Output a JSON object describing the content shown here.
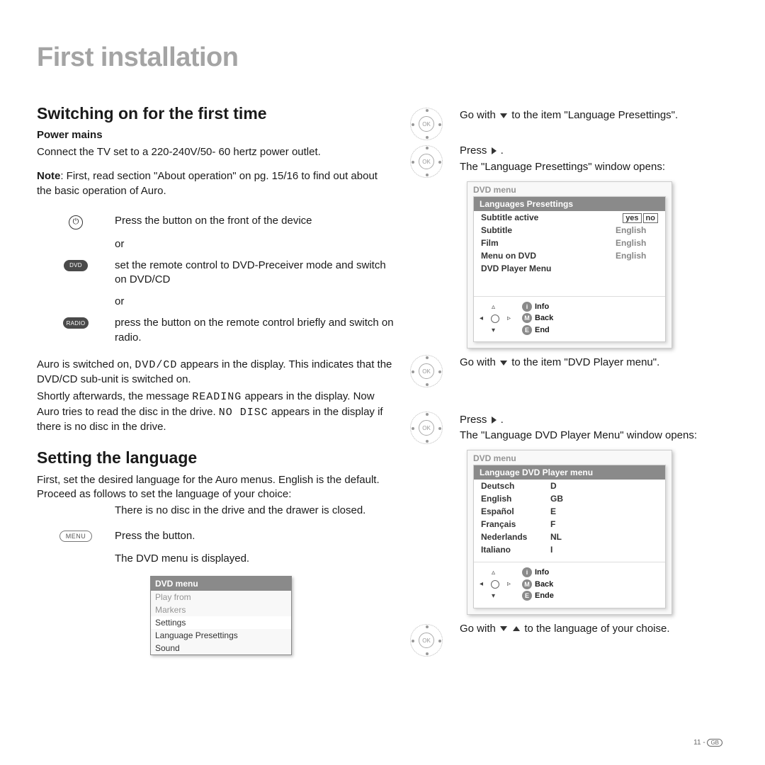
{
  "title": "First installation",
  "left": {
    "h2a": "Switching on for the first time",
    "h3a": "Power mains",
    "p_power": "Connect the TV set to a 220-240V/50- 60 hertz power outlet.",
    "note_b": "Note",
    "note_rest": ": First, read section \"About operation\" on pg. 15/16 to find out about the basic operation of Auro.",
    "row_power": "Press the button on the front of the device",
    "or": "or",
    "row_dvd": "set the remote control to DVD-Preceiver mode and switch on DVD/CD",
    "row_radio": "press the button on the remote control briefly and switch on radio.",
    "p_switched_1": "Auro is switched on, ",
    "lcd1": "DVD/CD",
    "p_switched_2": " appears in the display. This indicates that the DVD/CD sub-unit is switched on.",
    "p_read_1": "Shortly afterwards, the message ",
    "lcd2": "READING",
    "p_read_2": " appears in the display. Now Auro tries to read the disc in the drive. ",
    "lcd3": "NO DISC",
    "p_read_3": " appears in the display if there is no disc in the drive.",
    "h2b": "Setting the language",
    "p_lang_1": "First, set the desired language for the Auro menus. English is the default. Proceed as follows to set the language of your choice:",
    "p_lang_2": "There is no disc in the drive and the drawer is closed.",
    "row_menu": "Press the button.",
    "p_dvdshown": "The DVD menu is displayed.",
    "pill_dvd": "DVD",
    "pill_radio": "RADIO",
    "pill_menu": "MENU"
  },
  "osd_small": {
    "title": "DVD menu",
    "items": [
      "Play from",
      "Markers",
      "Settings",
      "Language Presettings",
      "Sound"
    ]
  },
  "right": {
    "s1_go": "Go with ",
    "s1_go2": " to the item \"Language Presettings\".",
    "s2_press": "Press ",
    "s2_dot": " .",
    "s2_opens": "The \"Language Presettings\" window opens:",
    "s3_go": "Go with ",
    "s3_go2": "  to the item \"DVD Player menu\".",
    "s4_press": "Press ",
    "s4_dot": " .",
    "s4_opens": "The \"Language DVD Player Menu\" window opens:",
    "s5_go": "Go with ",
    "s5_go2": "  to the language of your choise."
  },
  "osd_lang": {
    "outer": "DVD menu",
    "title": "Languages Presettings",
    "rows": [
      {
        "k": "Subtitle active",
        "yes": "yes",
        "no": "no"
      },
      {
        "k": "Subtitle",
        "v": "English"
      },
      {
        "k": "Film",
        "v": "English"
      },
      {
        "k": "Menu on DVD",
        "v": "English"
      },
      {
        "k": "DVD Player Menu",
        "v": ""
      }
    ],
    "legend": [
      {
        "b": "i",
        "t": "Info"
      },
      {
        "b": "M",
        "t": "Back"
      },
      {
        "b": "E",
        "t": "End"
      }
    ]
  },
  "osd_player": {
    "outer": "DVD menu",
    "title": "Language DVD Player menu",
    "rows": [
      {
        "k": "Deutsch",
        "v": "D"
      },
      {
        "k": "English",
        "v": "GB"
      },
      {
        "k": "Español",
        "v": "E"
      },
      {
        "k": "Français",
        "v": "F"
      },
      {
        "k": "Nederlands",
        "v": "NL"
      },
      {
        "k": "Italiano",
        "v": "I"
      }
    ],
    "legend": [
      {
        "b": "i",
        "t": "Info"
      },
      {
        "b": "M",
        "t": "Back"
      },
      {
        "b": "E",
        "t": "Ende"
      }
    ]
  },
  "ring_label": "OK",
  "footer": {
    "page": "11 -",
    "region": "GB"
  }
}
